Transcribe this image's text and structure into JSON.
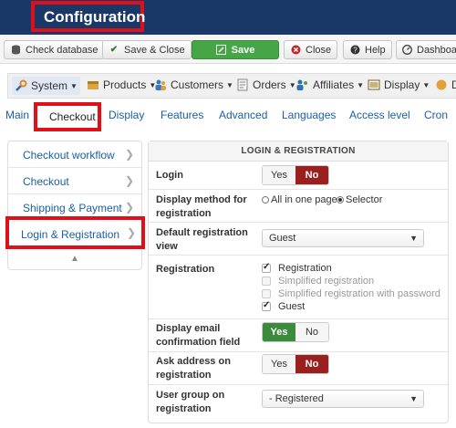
{
  "header": {
    "title": "Configuration"
  },
  "toolbar": {
    "check_database": "Check database",
    "save_close": "Save & Close",
    "save": "Save",
    "close": "Close",
    "help": "Help",
    "dashboard": "Dashboar"
  },
  "menu": {
    "system": "System",
    "products": "Products",
    "customers": "Customers",
    "orders": "Orders",
    "affiliates": "Affiliates",
    "display": "Display",
    "more": "D"
  },
  "tabs": {
    "main": "Main",
    "checkout": "Checkout",
    "display": "Display",
    "features": "Features",
    "advanced": "Advanced",
    "languages": "Languages",
    "access_level": "Access level",
    "cron": "Cron"
  },
  "sidebar": {
    "items": [
      {
        "label": "Checkout workflow"
      },
      {
        "label": "Checkout"
      },
      {
        "label": "Shipping & Payment"
      },
      {
        "label": "Login & Registration"
      }
    ]
  },
  "panel": {
    "heading": "LOGIN & REGISTRATION",
    "login": {
      "label": "Login",
      "yes": "Yes",
      "no": "No",
      "value": "No"
    },
    "display_method": {
      "label": "Display method for registration",
      "options": [
        "All in one page",
        "Selector"
      ],
      "selected": "Selector"
    },
    "default_view": {
      "label": "Default registration view",
      "value": "Guest"
    },
    "registration": {
      "label": "Registration",
      "options": [
        {
          "label": "Registration",
          "checked": true,
          "disabled": false
        },
        {
          "label": "Simplified registration",
          "checked": false,
          "disabled": true
        },
        {
          "label": "Simplified registration with password",
          "checked": false,
          "disabled": true
        },
        {
          "label": "Guest",
          "checked": true,
          "disabled": false
        }
      ]
    },
    "email_confirm": {
      "label": "Display email confirmation field",
      "yes": "Yes",
      "no": "No",
      "value": "Yes"
    },
    "ask_address": {
      "label": "Ask address on registration",
      "yes": "Yes",
      "no": "No",
      "value": "No"
    },
    "user_group": {
      "label": "User group on registration",
      "value": "- Registered"
    }
  },
  "colors": {
    "header_bg": "#1a3867",
    "highlight": "#e0101a",
    "link": "#1a5fa5",
    "yes_active": "#3c8b3c",
    "no_active": "#9a1f1f",
    "save_button": "#46a546"
  }
}
